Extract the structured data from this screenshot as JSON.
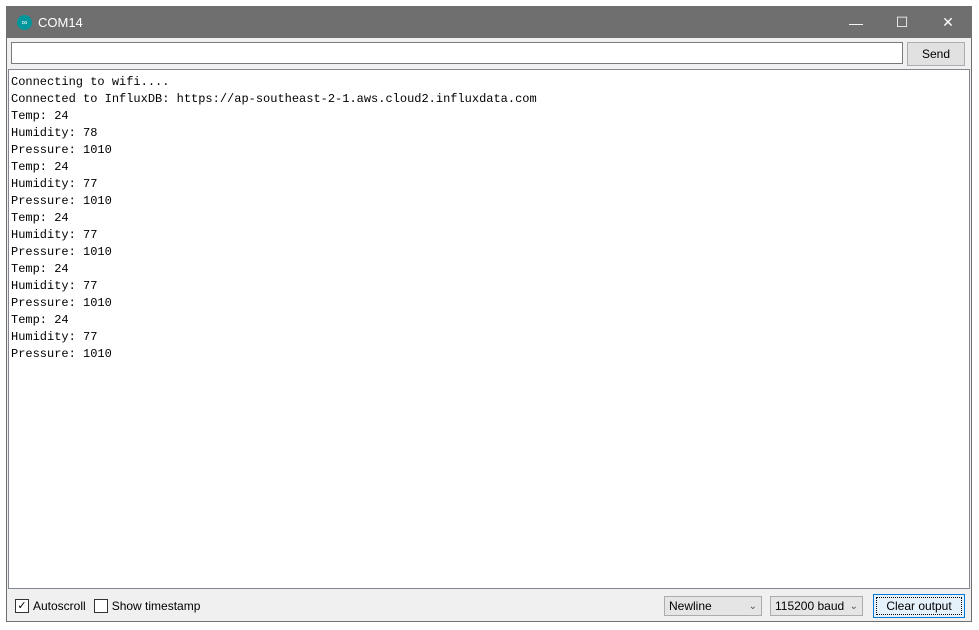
{
  "window": {
    "title": "COM14",
    "logo_icon": "arduino-logo",
    "accent": "#00979c"
  },
  "toolbar": {
    "input_value": "",
    "send_label": "Send"
  },
  "output": {
    "lines": [
      "Connecting to wifi....",
      "Connected to InfluxDB: https://ap-southeast-2-1.aws.cloud2.influxdata.com",
      "Temp: 24",
      "Humidity: 78",
      "Pressure: 1010",
      "Temp: 24",
      "Humidity: 77",
      "Pressure: 1010",
      "Temp: 24",
      "Humidity: 77",
      "Pressure: 1010",
      "Temp: 24",
      "Humidity: 77",
      "Pressure: 1010",
      "Temp: 24",
      "Humidity: 77",
      "Pressure: 1010"
    ]
  },
  "footer": {
    "autoscroll_label": "Autoscroll",
    "autoscroll_checked": true,
    "timestamp_label": "Show timestamp",
    "timestamp_checked": false,
    "line_ending": "Newline",
    "baud": "115200 baud",
    "clear_label": "Clear output"
  }
}
